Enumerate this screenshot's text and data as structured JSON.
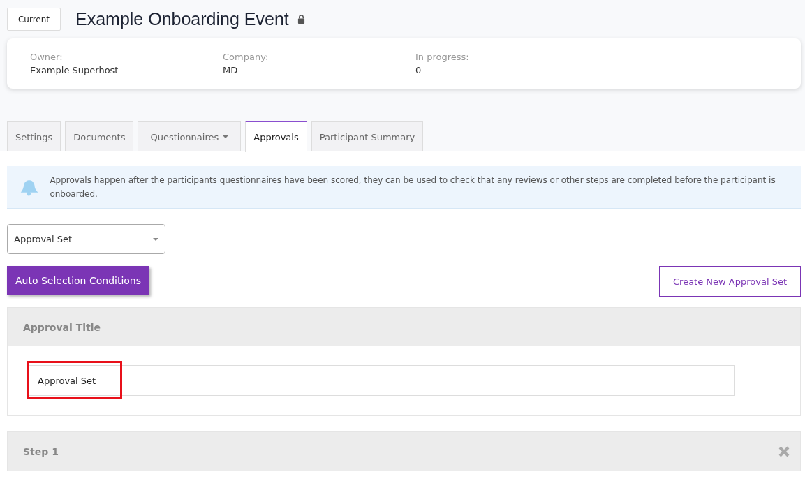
{
  "header": {
    "status_button": "Current",
    "title": "Example Onboarding Event",
    "locked": true
  },
  "info": [
    {
      "label": "Owner:",
      "value": "Example Superhost"
    },
    {
      "label": "Company:",
      "value": "MD"
    },
    {
      "label": "In progress:",
      "value": "0"
    }
  ],
  "tabs": [
    {
      "label": "Settings",
      "selected": false,
      "dropdown": false
    },
    {
      "label": "Documents",
      "selected": false,
      "dropdown": false
    },
    {
      "label": "Questionnaires",
      "selected": false,
      "dropdown": true
    },
    {
      "label": "Approvals",
      "selected": true,
      "dropdown": false
    },
    {
      "label": "Participant Summary",
      "selected": false,
      "dropdown": false
    }
  ],
  "alert": "Approvals happen after the participants questionnaires have been scored, they can be used to check that any reviews or other steps are completed before the participant is onboarded.",
  "approval_set_select": {
    "value": "Approval Set"
  },
  "buttons": {
    "auto_selection": "Auto Selection Conditions",
    "create_new": "Create New Approval Set"
  },
  "title_panel": {
    "heading": "Approval Title",
    "value": "Approval Set",
    "highlighted": true
  },
  "steps": [
    {
      "heading": "Step 1"
    }
  ]
}
